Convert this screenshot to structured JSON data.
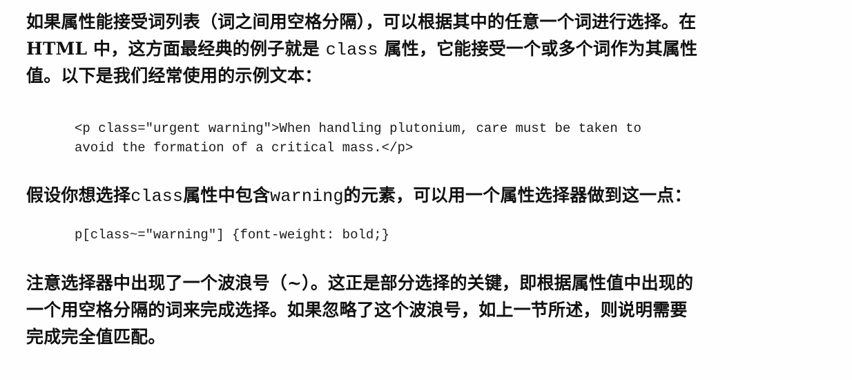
{
  "paragraph1": {
    "line1": "如果属性能接受词列表（词之间用空格分隔），可以根据其中的任意一个词进行选择。在",
    "line2_a": "HTML 中，这方面最经典的例子就是 ",
    "line2_code": "class",
    "line2_b": " 属性，它能接受一个或多个词作为其属性",
    "line3": "值。以下是我们经常使用的示例文本："
  },
  "code_example1": {
    "line1": "<p class=\"urgent warning\">When handling plutonium, care must be taken to",
    "line2": "avoid the formation of a critical mass.</p>"
  },
  "paragraph2": {
    "part_a": "假设你想选择",
    "code_a": "class",
    "part_b": "属性中包含",
    "code_b": "warning",
    "part_c": "的元素，可以用一个属性选择器做到这一点："
  },
  "code_example2": {
    "line1": "p[class~=\"warning\"] {font-weight: bold;}"
  },
  "paragraph3": {
    "line1": "注意选择器中出现了一个波浪号（~）。这正是部分选择的关键，即根据属性值中出现的",
    "line2": "一个用空格分隔的词来完成选择。如果忽略了这个波浪号，如上一节所述，则说明需要",
    "line3": "完成完全值匹配。"
  }
}
